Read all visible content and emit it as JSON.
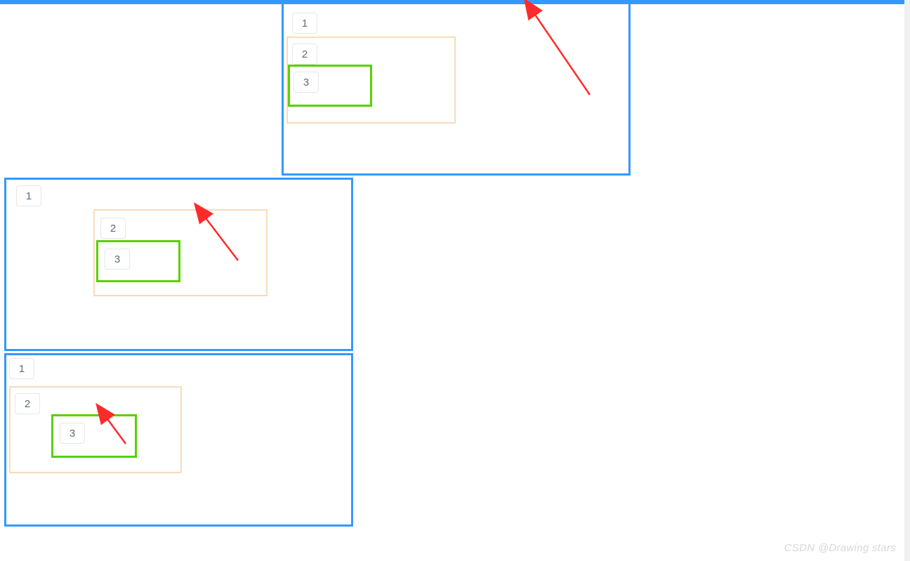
{
  "colors": {
    "blue_border": "#3399ff",
    "peach_border": "#f7dcb9",
    "green_border": "#58d102",
    "arrow": "#ff2a2a",
    "tag_text": "#5f6b78",
    "tag_border": "#e6e6e6",
    "watermark": "#d8d8d8"
  },
  "labels": {
    "one": "1",
    "two": "2",
    "three": "3"
  },
  "boxes": {
    "a": {
      "tag1": "1",
      "tag2": "2",
      "tag3": "3"
    },
    "b": {
      "tag1": "1",
      "tag2": "2",
      "tag3": "3"
    },
    "c": {
      "tag1": "1",
      "tag2": "2",
      "tag3": "3"
    }
  },
  "watermark": "CSDN @Drawing stars"
}
